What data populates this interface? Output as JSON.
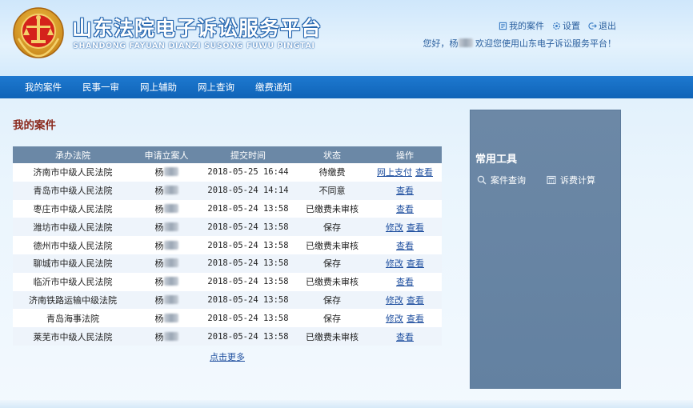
{
  "header": {
    "title": "山东法院电子诉讼服务平台",
    "subtitle": "SHANDONG FAYUAN DIANZI SUSONG FUWU PINGTAI",
    "links": [
      {
        "label": "我的案件",
        "icon": "case-icon"
      },
      {
        "label": "设置",
        "icon": "gear-icon"
      },
      {
        "label": "退出",
        "icon": "logout-icon"
      }
    ],
    "welcome_prefix": "您好，杨",
    "welcome_suffix": "欢迎您使用山东电子诉讼服务平台！"
  },
  "nav": {
    "items": [
      "我的案件",
      "民事一审",
      "网上辅助",
      "网上查询",
      "缴费通知"
    ]
  },
  "main": {
    "title": "我的案件",
    "columns": [
      "承办法院",
      "申请立案人",
      "提交时间",
      "状态",
      "操作"
    ],
    "rows": [
      {
        "court": "济南市中级人民法院",
        "applicant": "杨",
        "time": "2018-05-25 16:44",
        "status": "待缴费",
        "actions": [
          "网上支付",
          "查看"
        ]
      },
      {
        "court": "青岛市中级人民法院",
        "applicant": "杨",
        "time": "2018-05-24 14:14",
        "status": "不同意",
        "actions": [
          "查看"
        ]
      },
      {
        "court": "枣庄市中级人民法院",
        "applicant": "杨",
        "time": "2018-05-24 13:58",
        "status": "已缴费未审核",
        "actions": [
          "查看"
        ]
      },
      {
        "court": "潍坊市中级人民法院",
        "applicant": "杨",
        "time": "2018-05-24 13:58",
        "status": "保存",
        "actions": [
          "修改",
          "查看"
        ]
      },
      {
        "court": "德州市中级人民法院",
        "applicant": "杨",
        "time": "2018-05-24 13:58",
        "status": "已缴费未审核",
        "actions": [
          "查看"
        ]
      },
      {
        "court": "聊城市中级人民法院",
        "applicant": "杨",
        "time": "2018-05-24 13:58",
        "status": "保存",
        "actions": [
          "修改",
          "查看"
        ]
      },
      {
        "court": "临沂市中级人民法院",
        "applicant": "杨",
        "time": "2018-05-24 13:58",
        "status": "已缴费未审核",
        "actions": [
          "查看"
        ]
      },
      {
        "court": "济南铁路运输中级法院",
        "applicant": "杨",
        "time": "2018-05-24 13:58",
        "status": "保存",
        "actions": [
          "修改",
          "查看"
        ]
      },
      {
        "court": "青岛海事法院",
        "applicant": "杨",
        "time": "2018-05-24 13:58",
        "status": "保存",
        "actions": [
          "修改",
          "查看"
        ]
      },
      {
        "court": "莱芜市中级人民法院",
        "applicant": "杨",
        "time": "2018-05-24 13:58",
        "status": "已缴费未审核",
        "actions": [
          "查看"
        ]
      }
    ],
    "more_label": "点击更多"
  },
  "tools": {
    "title": "常用工具",
    "items": [
      {
        "label": "案件查询",
        "icon": "search-icon"
      },
      {
        "label": "诉费计算",
        "icon": "calculator-icon"
      }
    ]
  },
  "colors": {
    "nav_bg": "#1469c0",
    "table_header": "#6b88a6",
    "panel_bg": "#6785a4",
    "title_red": "#8b2a1e",
    "link_blue": "#1f4f9f"
  }
}
